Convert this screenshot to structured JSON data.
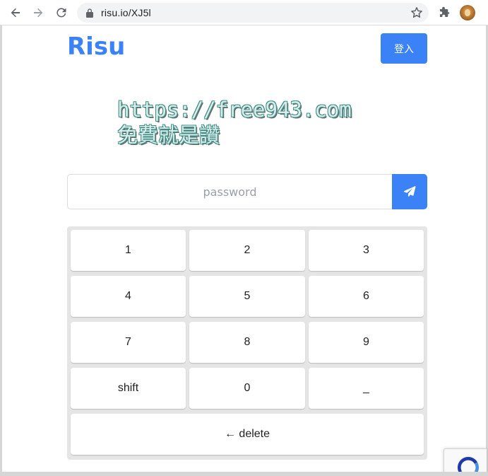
{
  "browser": {
    "url": "risu.io/XJ5l",
    "icons": {
      "back": "arrow-left-icon",
      "forward": "arrow-right-icon",
      "reload": "reload-icon",
      "lock": "lock-icon",
      "star": "star-icon",
      "extensions": "puzzle-icon",
      "profile": "avatar"
    }
  },
  "header": {
    "brand": "Risu",
    "login_label": "登入"
  },
  "watermark": {
    "line1": "https://free943.com",
    "line2": "免費就是讚"
  },
  "password": {
    "placeholder": "password",
    "value": ""
  },
  "keypad": {
    "keys": [
      "1",
      "2",
      "3",
      "4",
      "5",
      "6",
      "7",
      "8",
      "9",
      "shift",
      "0",
      "_"
    ],
    "delete_label": "← delete"
  },
  "colors": {
    "accent": "#3b82f6",
    "keypad_bg": "#e5e5e5",
    "watermark_outline": "#3e8e87"
  }
}
